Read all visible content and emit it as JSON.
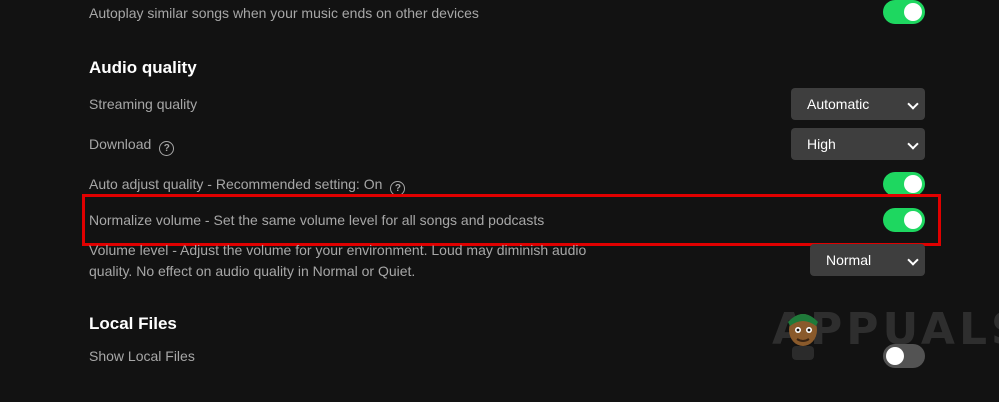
{
  "playback": {
    "autoplay_label": "Autoplay similar songs when your music ends on other devices",
    "autoplay_on": true
  },
  "audio_quality": {
    "title": "Audio quality",
    "streaming_label": "Streaming quality",
    "streaming_value": "Automatic",
    "download_label": "Download",
    "download_value": "High",
    "auto_adjust_label": "Auto adjust quality - Recommended setting: On",
    "auto_adjust_on": true,
    "normalize_label": "Normalize volume - Set the same volume level for all songs and podcasts",
    "normalize_on": true,
    "volume_level_label": "Volume level - Adjust the volume for your environment. Loud may diminish audio quality. No effect on audio quality in Normal or Quiet.",
    "volume_level_value": "Normal"
  },
  "local_files": {
    "title": "Local Files",
    "show_label": "Show Local Files",
    "show_on": false
  },
  "icons": {
    "help": "?"
  },
  "watermark": "APPUALS",
  "colors": {
    "background": "#121212",
    "accent": "#1ed760",
    "highlight": "#e00000"
  }
}
